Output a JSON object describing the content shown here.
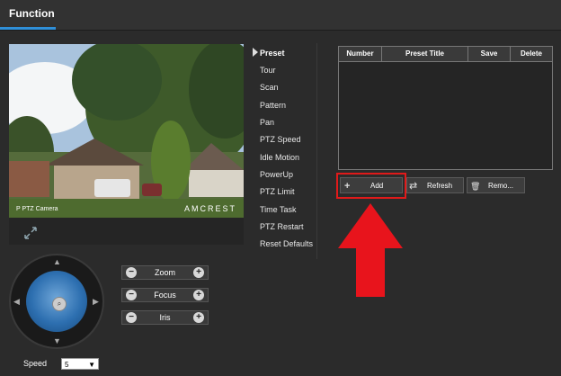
{
  "header": {
    "tab_label": "Function"
  },
  "video": {
    "camera_label": "P PTZ Camera",
    "brand": "AMCREST"
  },
  "menu": {
    "items": [
      "Preset",
      "Tour",
      "Scan",
      "Pattern",
      "Pan",
      "PTZ Speed",
      "Idle Motion",
      "PowerUp",
      "PTZ Limit",
      "Time Task",
      "PTZ Restart",
      "Reset Defaults"
    ],
    "active": "Preset"
  },
  "preset_table": {
    "columns": [
      "Number",
      "Preset Title",
      "Save",
      "Delete"
    ]
  },
  "buttons": {
    "add": "Add",
    "refresh": "Refresh",
    "remove": "Remo..."
  },
  "controls": {
    "zoom": "Zoom",
    "focus": "Focus",
    "iris": "Iris"
  },
  "speed": {
    "label": "Speed",
    "value": "5"
  },
  "colors": {
    "accent": "#2f8fd8",
    "highlight": "#e01a1a",
    "arrow": "#e8141c"
  },
  "icons": {
    "add": "plus-icon",
    "refresh": "refresh-icon",
    "remove": "trash-icon",
    "fullscreen": "expand-icon"
  }
}
